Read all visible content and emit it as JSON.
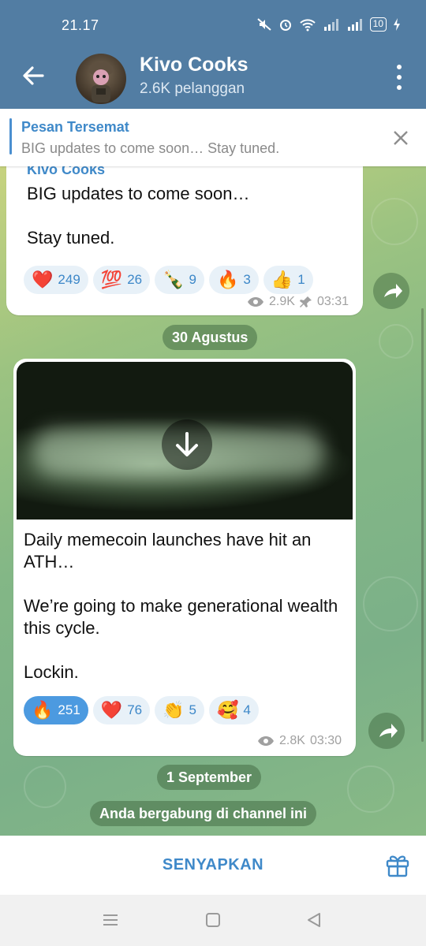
{
  "status_bar": {
    "time": "21.17",
    "battery": "10"
  },
  "header": {
    "title": "Kivo Cooks",
    "subtitle": "2.6K pelanggan"
  },
  "pinned": {
    "title": "Pesan Tersemat",
    "text": "BIG updates to come soon…  Stay tuned."
  },
  "messages": [
    {
      "sender": "Kivo Cooks",
      "text": "BIG updates to come soon…\n\nStay tuned.",
      "reactions": [
        {
          "emoji": "❤️",
          "count": "249"
        },
        {
          "emoji": "💯",
          "count": "26"
        },
        {
          "emoji": "🍾",
          "count": "9"
        },
        {
          "emoji": "🔥",
          "count": "3"
        },
        {
          "emoji": "👍",
          "count": "1"
        }
      ],
      "views": "2.9K",
      "time": "03:31"
    },
    {
      "text": "Daily memecoin launches have hit an ATH…\n\nWe’re going to make generational wealth this cycle.\n\nLockin.",
      "reactions": [
        {
          "emoji": "🔥",
          "count": "251",
          "active": true
        },
        {
          "emoji": "❤️",
          "count": "76"
        },
        {
          "emoji": "👏",
          "count": "5"
        },
        {
          "emoji": "🥰",
          "count": "4"
        }
      ],
      "views": "2.8K",
      "time": "03:30"
    }
  ],
  "date_separators": [
    "30 Agustus",
    "1 September"
  ],
  "service_message": "Anda bergabung di channel ini",
  "bottom": {
    "mute_label": "SENYAPKAN"
  },
  "colors": {
    "header": "#527da3",
    "accent": "#3f89c9",
    "reaction_active": "#4c9ae0"
  }
}
